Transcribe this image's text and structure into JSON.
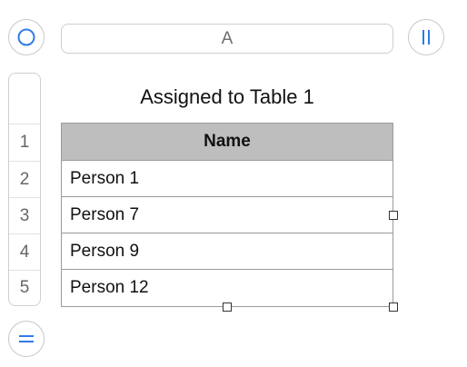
{
  "column_header": {
    "label": "A"
  },
  "row_numbers": [
    "1",
    "2",
    "3",
    "4",
    "5"
  ],
  "table": {
    "title": "Assigned to Table 1",
    "header": "Name",
    "rows": [
      "Person 1",
      "Person 7",
      "Person 9",
      "Person 12"
    ]
  },
  "colors": {
    "accent": "#2f7be6",
    "header_fill": "#bebebe"
  },
  "icons": {
    "top_left": "circle-icon",
    "top_right": "pause-bars-icon",
    "bottom_left": "equals-icon"
  }
}
